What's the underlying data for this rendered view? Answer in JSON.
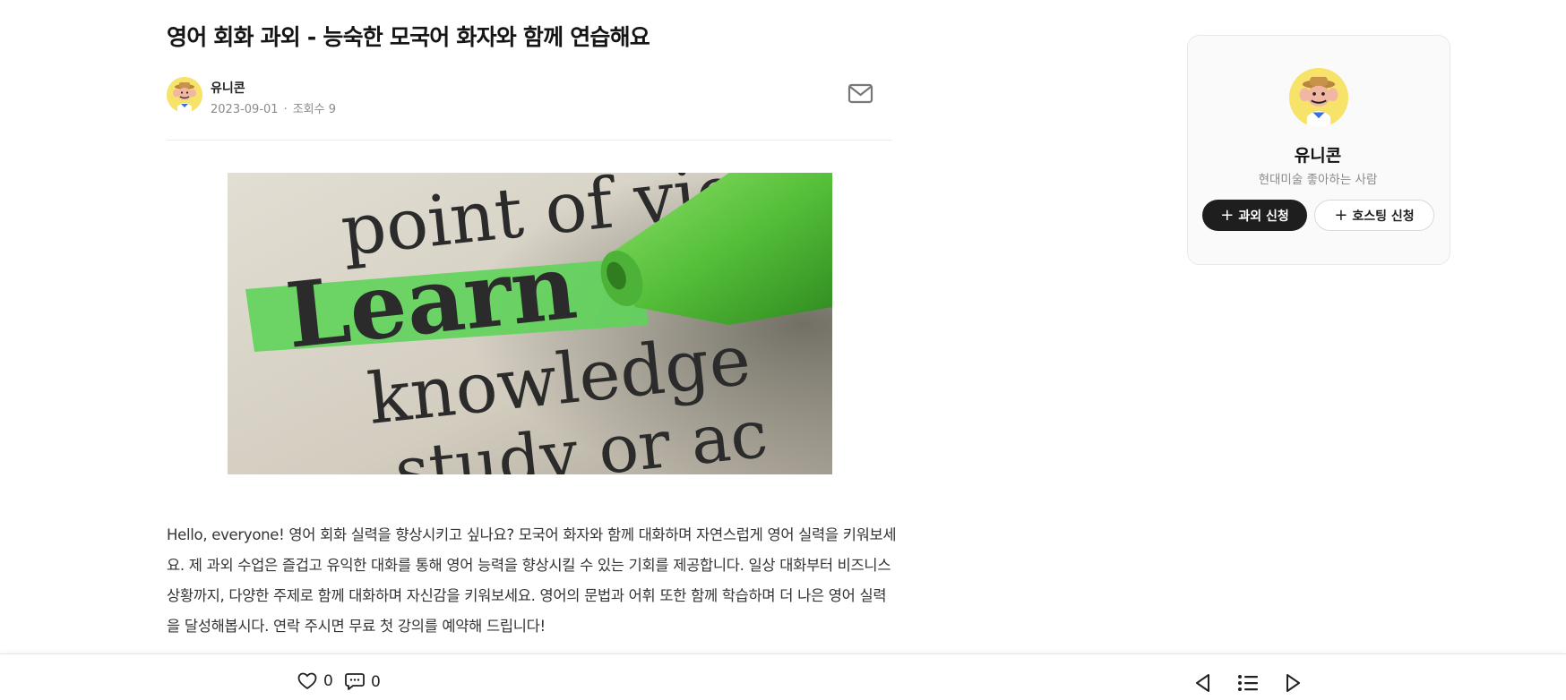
{
  "post": {
    "title": "영어 회화 과외 - 능숙한 모국어 화자와 함께 연습해요",
    "author": "유니콘",
    "date": "2023-09-01",
    "views_label": "조회수 9",
    "body": "Hello, everyone! 영어 회화 실력을 향상시키고 싶나요? 모국어 화자와 함께 대화하며 자연스럽게 영어 실력을 키워보세요. 제 과외 수업은 즐겁고 유익한 대화를 통해 영어 능력을 향상시킬 수 있는 기회를 제공합니다. 일상 대화부터 비즈니스 상황까지, 다양한 주제로 함께 대화하며 자신감을 키워보세요. 영어의 문법과 어휘 또한 함께 학습하며 더 나은 영어 실력을 달성해봅시다. 연락 주시면 무료 첫 강의를 예약해 드립니다!"
  },
  "hero_image": {
    "words": [
      "point of view",
      "Learn",
      "knowledge",
      "study or ac"
    ],
    "colors": {
      "paper": "#d8d3c6",
      "highlight": "#5fd35a",
      "marker": "#4fb93a",
      "ink": "#2b2b2b"
    }
  },
  "bottom_bar": {
    "likes": "0",
    "comments": "0"
  },
  "profile": {
    "name": "유니콘",
    "bio": "현대미술 좋아하는 사람",
    "lesson_button": "과외 신청",
    "hosting_button": "호스팅 신청",
    "plus_symbol": "+"
  },
  "icons": {
    "mail": "mail-icon",
    "heart": "heart-icon",
    "comment": "comment-icon",
    "prev": "prev-arrow-icon",
    "list": "list-icon",
    "next": "next-arrow-icon"
  },
  "colors": {
    "primary_button": "#1e1e1e",
    "avatar_bg": "#f7e36a",
    "muted_text": "#8a8a8a"
  }
}
